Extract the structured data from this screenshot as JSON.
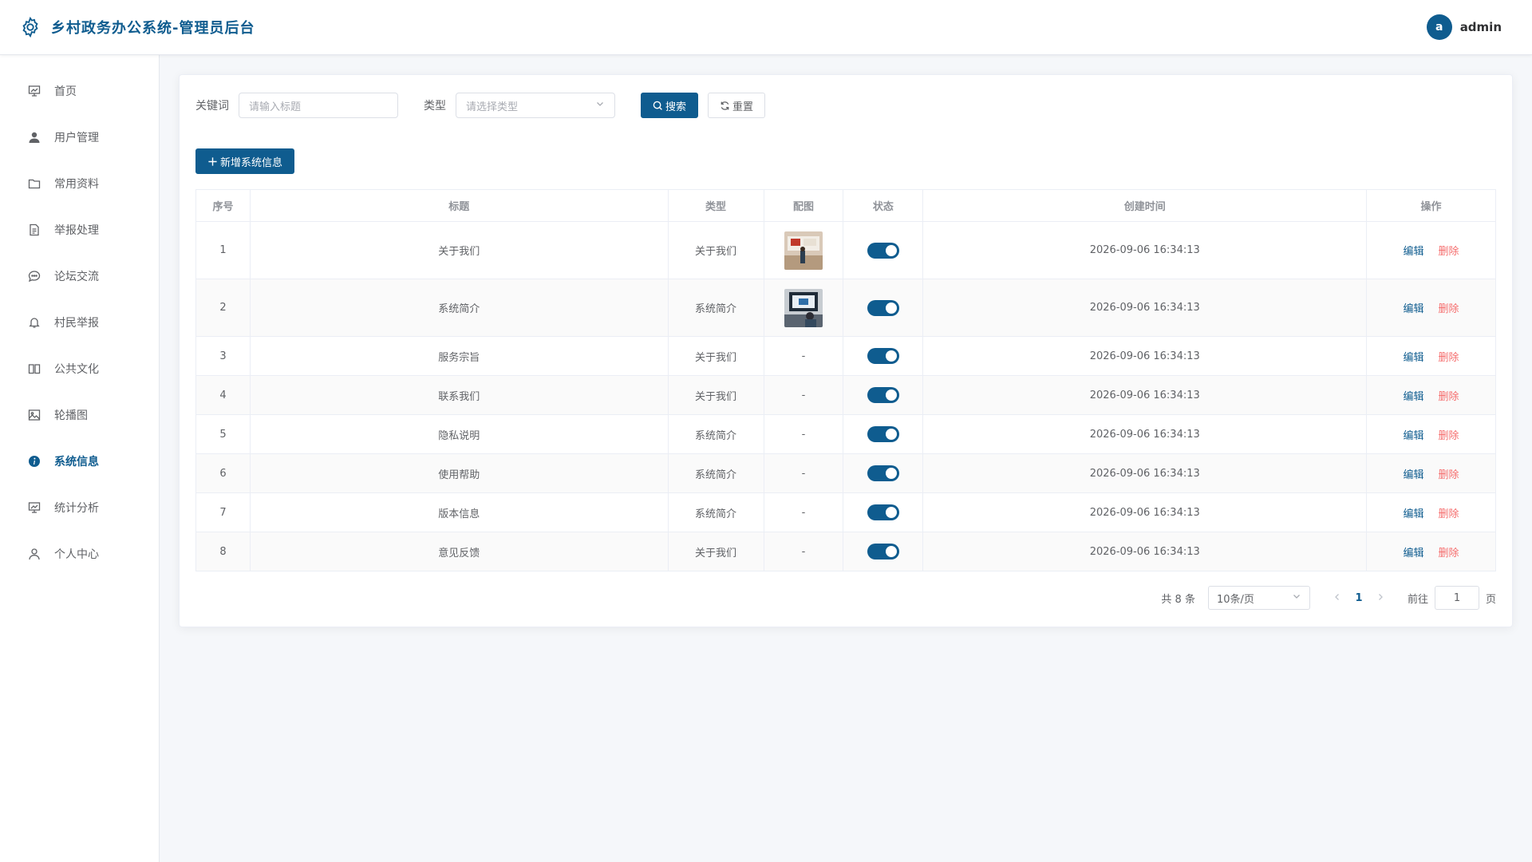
{
  "header": {
    "title": "乡村政务办公系统-管理员后台",
    "avatar_letter": "a",
    "username": "admin"
  },
  "sidebar": {
    "items": [
      {
        "label": "首页",
        "icon": "chart-board-icon"
      },
      {
        "label": "用户管理",
        "icon": "user-icon"
      },
      {
        "label": "常用资料",
        "icon": "folder-icon"
      },
      {
        "label": "举报处理",
        "icon": "document-icon"
      },
      {
        "label": "论坛交流",
        "icon": "chat-icon"
      },
      {
        "label": "村民举报",
        "icon": "bell-icon"
      },
      {
        "label": "公共文化",
        "icon": "book-icon"
      },
      {
        "label": "轮播图",
        "icon": "picture-icon"
      },
      {
        "label": "系统信息",
        "icon": "info-icon",
        "active": true
      },
      {
        "label": "统计分析",
        "icon": "chart-board-icon"
      },
      {
        "label": "个人中心",
        "icon": "user-outline-icon"
      }
    ]
  },
  "search": {
    "keyword_label": "关键词",
    "keyword_placeholder": "请输入标题",
    "type_label": "类型",
    "type_placeholder": "请选择类型",
    "search_btn": "搜索",
    "reset_btn": "重置"
  },
  "add_btn": "新增系统信息",
  "table": {
    "columns": [
      "序号",
      "标题",
      "类型",
      "配图",
      "状态",
      "创建时间",
      "操作"
    ],
    "rows": [
      {
        "no": "1",
        "title": "关于我们",
        "type": "关于我们",
        "image": true,
        "status": true,
        "created": "2026-09-06 16:34:13"
      },
      {
        "no": "2",
        "title": "系统简介",
        "type": "系统简介",
        "image": true,
        "status": true,
        "created": "2026-09-06 16:34:13"
      },
      {
        "no": "3",
        "title": "服务宗旨",
        "type": "关于我们",
        "image": "-",
        "status": true,
        "created": "2026-09-06 16:34:13"
      },
      {
        "no": "4",
        "title": "联系我们",
        "type": "关于我们",
        "image": "-",
        "status": true,
        "created": "2026-09-06 16:34:13"
      },
      {
        "no": "5",
        "title": "隐私说明",
        "type": "系统简介",
        "image": "-",
        "status": true,
        "created": "2026-09-06 16:34:13"
      },
      {
        "no": "6",
        "title": "使用帮助",
        "type": "系统简介",
        "image": "-",
        "status": true,
        "created": "2026-09-06 16:34:13"
      },
      {
        "no": "7",
        "title": "版本信息",
        "type": "系统简介",
        "image": "-",
        "status": true,
        "created": "2026-09-06 16:34:13"
      },
      {
        "no": "8",
        "title": "意见反馈",
        "type": "关于我们",
        "image": "-",
        "status": true,
        "created": "2026-09-06 16:34:13"
      }
    ],
    "edit_label": "编辑",
    "delete_label": "删除"
  },
  "pagination": {
    "total": "共 8 条",
    "page_size": "10条/页",
    "current_page": "1",
    "goto_label": "前往",
    "goto_value": "1",
    "page_suffix": "页"
  },
  "colors": {
    "primary": "#0f5c8f",
    "danger": "#f56c6c"
  }
}
